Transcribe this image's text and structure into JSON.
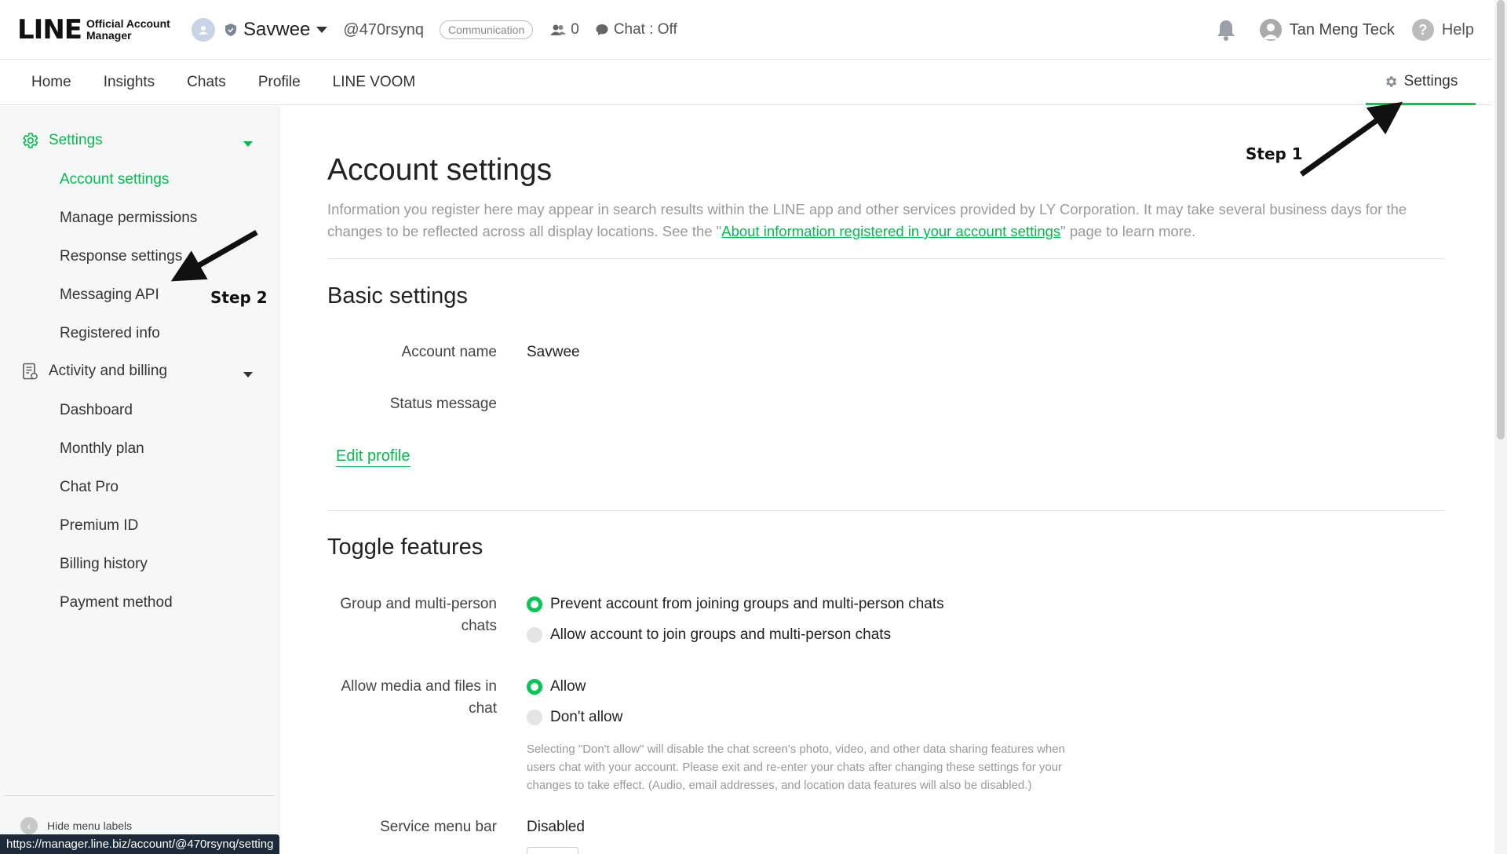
{
  "header": {
    "logo_main": "LINE",
    "logo_sub_line1": "Official Account",
    "logo_sub_line2": "Manager",
    "account_name": "Savwee",
    "account_id": "@470rsynq",
    "category_badge": "Communication",
    "friend_count": "0",
    "chat_status": "Chat : Off",
    "user_name": "Tan Meng Teck",
    "help_label": "Help"
  },
  "nav": {
    "tabs": [
      "Home",
      "Insights",
      "Chats",
      "Profile",
      "LINE VOOM"
    ],
    "settings_label": "Settings"
  },
  "sidebar": {
    "settings_group": "Settings",
    "settings_items": [
      "Account settings",
      "Manage permissions",
      "Response settings",
      "Messaging API",
      "Registered info"
    ],
    "billing_group": "Activity and billing",
    "billing_items": [
      "Dashboard",
      "Monthly plan",
      "Chat Pro",
      "Premium ID",
      "Billing history",
      "Payment method"
    ],
    "hide_labels": "Hide menu labels"
  },
  "main": {
    "title": "Account settings",
    "intro_before": "Information you register here may appear in search results within the LINE app and other services provided by LY Corporation. It may take several business days for the changes to be reflected across all display locations. See the \"",
    "intro_link": "About information registered in your account settings",
    "intro_after": "\" page to learn more.",
    "basic_heading": "Basic settings",
    "account_name_label": "Account name",
    "account_name_value": "Savwee",
    "status_message_label": "Status message",
    "edit_profile": "Edit profile",
    "toggle_heading": "Toggle features",
    "group_label": "Group and multi-person chats",
    "group_option_1": "Prevent account from joining groups and multi-person chats",
    "group_option_2": "Allow account to join groups and multi-person chats",
    "media_label": "Allow media and files in chat",
    "media_option_1": "Allow",
    "media_option_2": "Don't allow",
    "media_note": "Selecting \"Don't allow\" will disable the chat screen's photo, video, and other data sharing features when users chat with your account. Please exit and re-enter your chats after changing these settings for your changes to take effect. (Audio, email addresses, and location data features will also be disabled.)",
    "service_menu_label": "Service menu bar",
    "service_menu_value": "Disabled"
  },
  "annotations": {
    "step1": "Step 1",
    "step2": "Step 2"
  },
  "status_url": "https://manager.line.biz/account/@470rsynq/setting",
  "colors": {
    "accent_green": "#06c755",
    "link_green": "#06b94f"
  }
}
